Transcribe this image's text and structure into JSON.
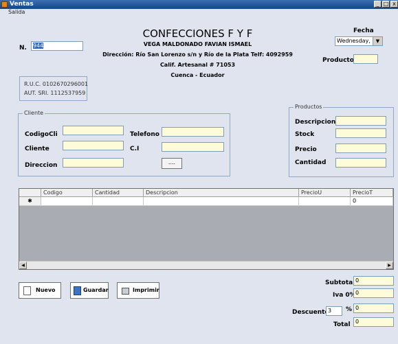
{
  "window": {
    "title": "Ventas",
    "min": "_",
    "max": "□",
    "close": "x"
  },
  "menu": {
    "items": [
      "Salida"
    ]
  },
  "header": {
    "company": "CONFECCIONES F Y F",
    "owner": "VEGA MALDONADO FAVIAN ISMAEL",
    "address": "Dirección: Río San Lorenzo s/n y Río de la Plata  Telf: 4092959",
    "artisan": "Calif. Artesanal # 71053",
    "city": "Cuenca - Ecuador"
  },
  "invoice": {
    "number_label": "N.",
    "number_value": "944"
  },
  "fecha": {
    "label": "Fecha",
    "value": "Wednesday,"
  },
  "producto": {
    "label": "Producto",
    "value": ""
  },
  "ruc": {
    "ruc": "R.U.C. 0102670296001",
    "aut": "AUT. SRI. 1112537959"
  },
  "cliente": {
    "title": "Cliente",
    "codigo_label": "CodigoCli",
    "codigo_value": "",
    "cliente_label": "Cliente",
    "cliente_value": "",
    "direccion_label": "Direccion",
    "direccion_value": "",
    "telefono_label": "Telefono",
    "telefono_value": "",
    "ci_label": "C.I",
    "ci_value": "",
    "lookup_button": "...."
  },
  "productos": {
    "title": "Productos",
    "descripcion_label": "Descripcion",
    "descripcion_value": "",
    "stock_label": "Stock",
    "stock_value": "",
    "precio_label": "Precio",
    "precio_value": "",
    "cantidad_label": "Cantidad",
    "cantidad_value": ""
  },
  "grid": {
    "columns": [
      "Codigo",
      "Cantidad",
      "Descripcion",
      "PrecioU",
      "PrecioT"
    ],
    "new_row_marker": "✱",
    "new_row": [
      "",
      "",
      "",
      "",
      "0"
    ]
  },
  "buttons": {
    "nuevo": "Nuevo",
    "guardar": "Guardar",
    "imprimir": "Imprimir"
  },
  "totals": {
    "subtotal_label": "Subtotal",
    "subtotal_value": "0",
    "iva_label": "Iva   0%",
    "iva_value": "0",
    "descuento_label": "Descuento",
    "descuento_pct_value": "3",
    "pct_sign": "%",
    "descuento_value": "0",
    "total_label": "Total",
    "total_value": "0"
  },
  "icons": [
    "app-icon",
    "new-document-icon",
    "save-icon",
    "print-icon",
    "dropdown-arrow-icon",
    "scroll-left-icon",
    "scroll-right-icon"
  ]
}
